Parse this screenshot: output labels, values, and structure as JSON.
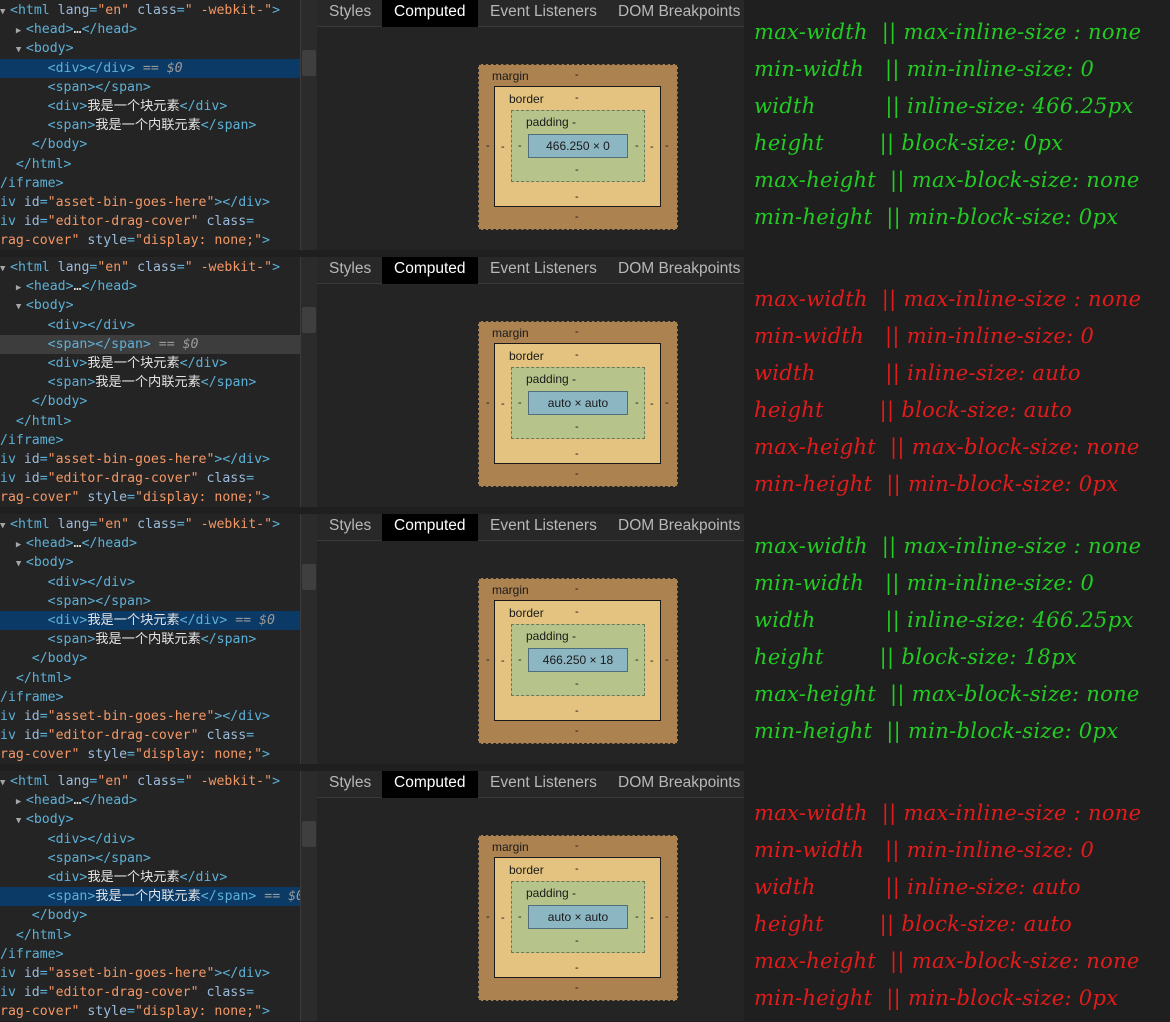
{
  "tabs": [
    "Styles",
    "Computed",
    "Event Listeners",
    "DOM Breakpoints"
  ],
  "tree_common": {
    "html_open": "<html lang=\"en\" class=\" -webkit-\">",
    "head": "<head>…</head>",
    "body_open": "<body>",
    "div_empty": "<div></div>",
    "span_empty": "<span></span>",
    "div_text": "我是一个块元素",
    "span_text": "我是一个内联元素",
    "body_close": "</body>",
    "html_close": "</html>",
    "iframe_close": "/iframe>",
    "asset_bin": "iv id=\"asset-bin-goes-here\"></div>",
    "drag_cover_1": "iv id=\"editor-drag-cover\" class=",
    "drag_cover_2": "rag-cover\" style=\"display: none;\">",
    "dollar0": " == $0"
  },
  "box_labels": {
    "margin": "margin",
    "border": "border",
    "padding": "padding -",
    "dash": "-"
  },
  "panels": [
    {
      "selected": "div_empty",
      "content_size": "466.250 × 0",
      "note_color": "green",
      "notes": [
        "max-width  || max-inline-size : none",
        "min-width   || min-inline-size: 0",
        "width          || inline-size: 466.25px",
        "height        || block-size: 0px",
        "max-height  || max-block-size: none",
        "min-height  || min-block-size: 0px"
      ]
    },
    {
      "selected": "span_empty",
      "content_size": "auto × auto",
      "note_color": "red",
      "notes": [
        "max-width  || max-inline-size : none",
        "min-width   || min-inline-size: 0",
        "width          || inline-size: auto",
        "height        || block-size: auto",
        "max-height  || max-block-size: none",
        "min-height  || min-block-size: 0px"
      ]
    },
    {
      "selected": "div_text",
      "content_size": "466.250 × 18",
      "note_color": "green",
      "notes": [
        "max-width  || max-inline-size : none",
        "min-width   || min-inline-size: 0",
        "width          || inline-size: 466.25px",
        "height        || block-size: 18px",
        "max-height  || max-block-size: none",
        "min-height  || min-block-size: 0px"
      ]
    },
    {
      "selected": "span_text",
      "content_size": "auto × auto",
      "note_color": "red",
      "notes": [
        "max-width  || max-inline-size : none",
        "min-width   || min-inline-size: 0",
        "width          || inline-size: auto",
        "height        || block-size: auto",
        "max-height  || max-block-size: none",
        "min-height  || min-block-size: 0px"
      ]
    }
  ],
  "colors": {
    "green_note": "#22cc22",
    "red_note": "#e41b1b",
    "selection": "#0b3a67",
    "margin": "#ad8251",
    "border": "#e3c37f",
    "padding": "#b6c48b",
    "content": "#8db6c3"
  }
}
